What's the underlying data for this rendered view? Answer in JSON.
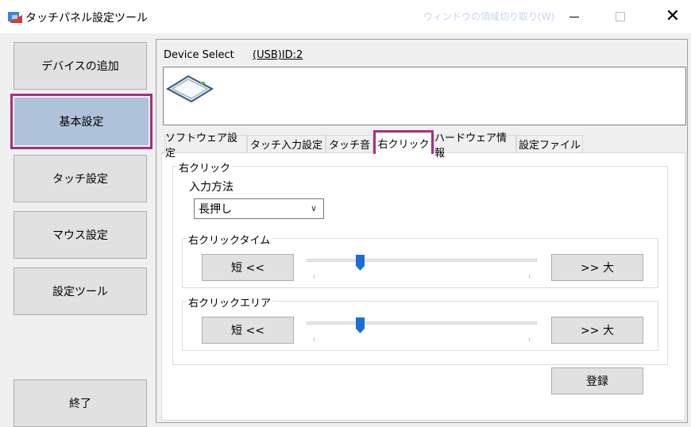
{
  "window": {
    "title": "タッチパネル設定ツール",
    "snip_hint": "ウィンドウの領域切り取り(W)",
    "minimize_symbol": "",
    "close_symbol": "✕"
  },
  "sidebar": {
    "items": [
      {
        "label": "デバイスの追加"
      },
      {
        "label": "基本設定"
      },
      {
        "label": "タッチ設定"
      },
      {
        "label": "マウス設定"
      },
      {
        "label": "設定ツール"
      },
      {
        "label": "終了"
      }
    ]
  },
  "device": {
    "label": "Device Select",
    "id_link": "(USB)ID:2"
  },
  "tabs": [
    {
      "label": "ソフトウェア設定"
    },
    {
      "label": "タッチ入力設定"
    },
    {
      "label": "タッチ音"
    },
    {
      "label": "右クリック"
    },
    {
      "label": "ハードウェア情報"
    },
    {
      "label": "設定ファイル"
    }
  ],
  "right_click": {
    "group_title": "右クリック",
    "input_method_label": "入力方法",
    "input_method_value": "長押し",
    "time": {
      "title": "右クリックタイム",
      "short_label": "短 <<",
      "long_label": ">> 大",
      "slider_value": 0.23
    },
    "area": {
      "title": "右クリックエリア",
      "short_label": "短 <<",
      "long_label": ">> 大",
      "slider_value": 0.23
    },
    "register_label": "登録"
  },
  "colors": {
    "highlight": "#a4317f",
    "selected_bg": "#aec3da",
    "thumb": "#1a6fd6"
  }
}
